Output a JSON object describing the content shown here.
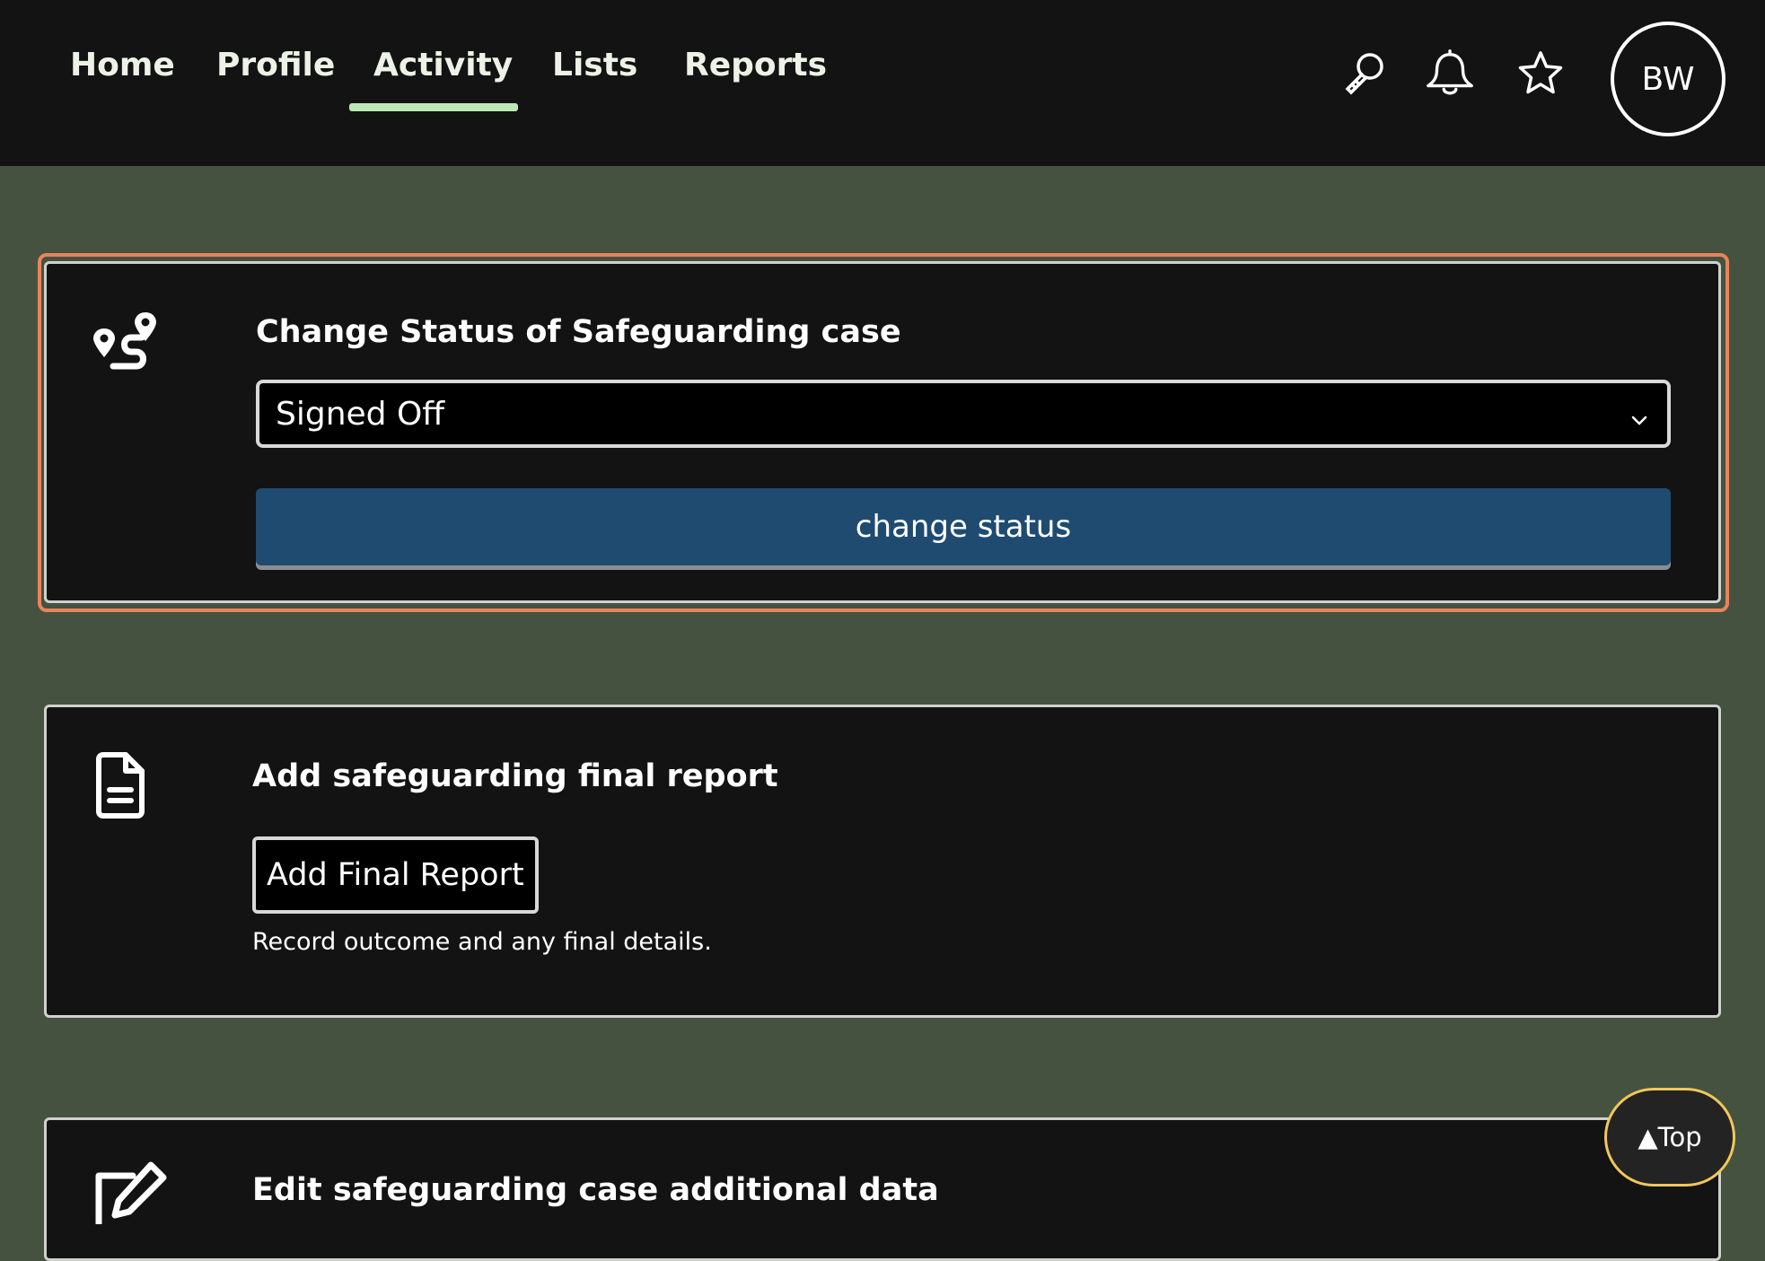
{
  "nav": {
    "items": [
      {
        "label": "Home"
      },
      {
        "label": "Profile"
      },
      {
        "label": "Activity",
        "active": true
      },
      {
        "label": "Lists"
      },
      {
        "label": "Reports"
      }
    ],
    "icons": [
      "search-icon",
      "bell-icon",
      "star-icon"
    ],
    "avatar_initials": "BW"
  },
  "status_card": {
    "icon": "route-icon",
    "title": "Change Status of Safeguarding case",
    "select_value": "Signed Off",
    "button_label": "change status"
  },
  "report_card": {
    "icon": "document-icon",
    "title": "Add safeguarding final report",
    "button_label": "Add Final Report",
    "help_text": "Record outcome and any final details."
  },
  "edit_card": {
    "icon": "edit-icon",
    "title": "Edit safeguarding case additional data"
  },
  "back_to_top": {
    "label": "▲Top"
  },
  "colors": {
    "page_background": "#455240",
    "header_background": "#131313",
    "card_background": "#131313",
    "active_tab_underline": "#bde8b5",
    "focus_outline": "#e8845c",
    "primary_button": "#1f4b71",
    "top_button_border": "#f1c75a"
  }
}
